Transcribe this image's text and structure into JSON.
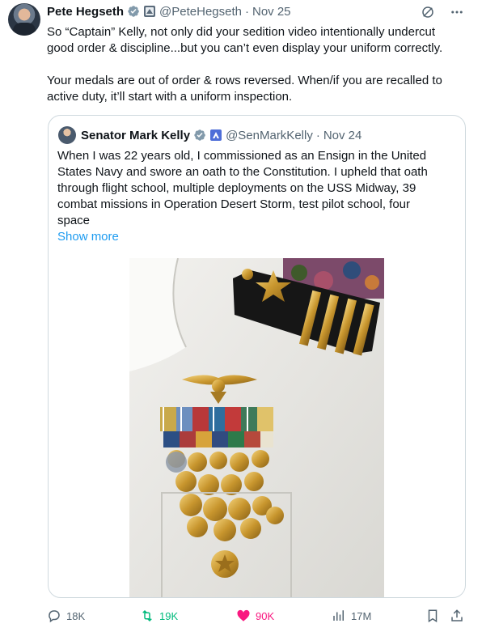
{
  "tweet": {
    "author_name": "Pete Hegseth",
    "handle": "@PeteHegseth",
    "separator": "·",
    "date": "Nov 25",
    "text_line1": "So “Captain” Kelly, not only did your sedition video intentionally undercut",
    "text_line2": "good order & discipline...but you can’t even display your uniform correctly.",
    "text_line3": "Your medals are out of order & rows reversed. When/if you are recalled to",
    "text_line4": "active duty, it’ll start with a uniform inspection."
  },
  "quote": {
    "author_name": "Senator Mark Kelly",
    "handle": "@SenMarkKelly",
    "separator": "·",
    "date": "Nov 24",
    "text_line1": "When I was 22 years old, I commissioned as an Ensign in the United",
    "text_line2": "States Navy and swore an oath to the Constitution. I upheld that oath",
    "text_line3": "through flight school, multiple deployments on the USS Midway, 39",
    "text_line4": "combat missions in Operation Desert Storm, test pilot school, four",
    "text_line5": "space",
    "show_more": "Show more"
  },
  "actions": {
    "replies": "18K",
    "reposts": "19K",
    "likes": "90K",
    "views": "17M"
  },
  "icons": {
    "verified": "verified-badge-icon",
    "affiliate": "government-badge-icon",
    "grok": "grok-icon",
    "more": "more-icon",
    "reply": "reply-icon",
    "repost": "repost-icon",
    "like": "heart-icon",
    "views": "views-icon",
    "bookmark": "bookmark-icon",
    "share": "share-icon"
  },
  "colors": {
    "text": "#0f1419",
    "secondary": "#536471",
    "link": "#1d9bf0",
    "repost": "#00ba7c",
    "like": "#f91880",
    "border": "#cfd9de"
  }
}
